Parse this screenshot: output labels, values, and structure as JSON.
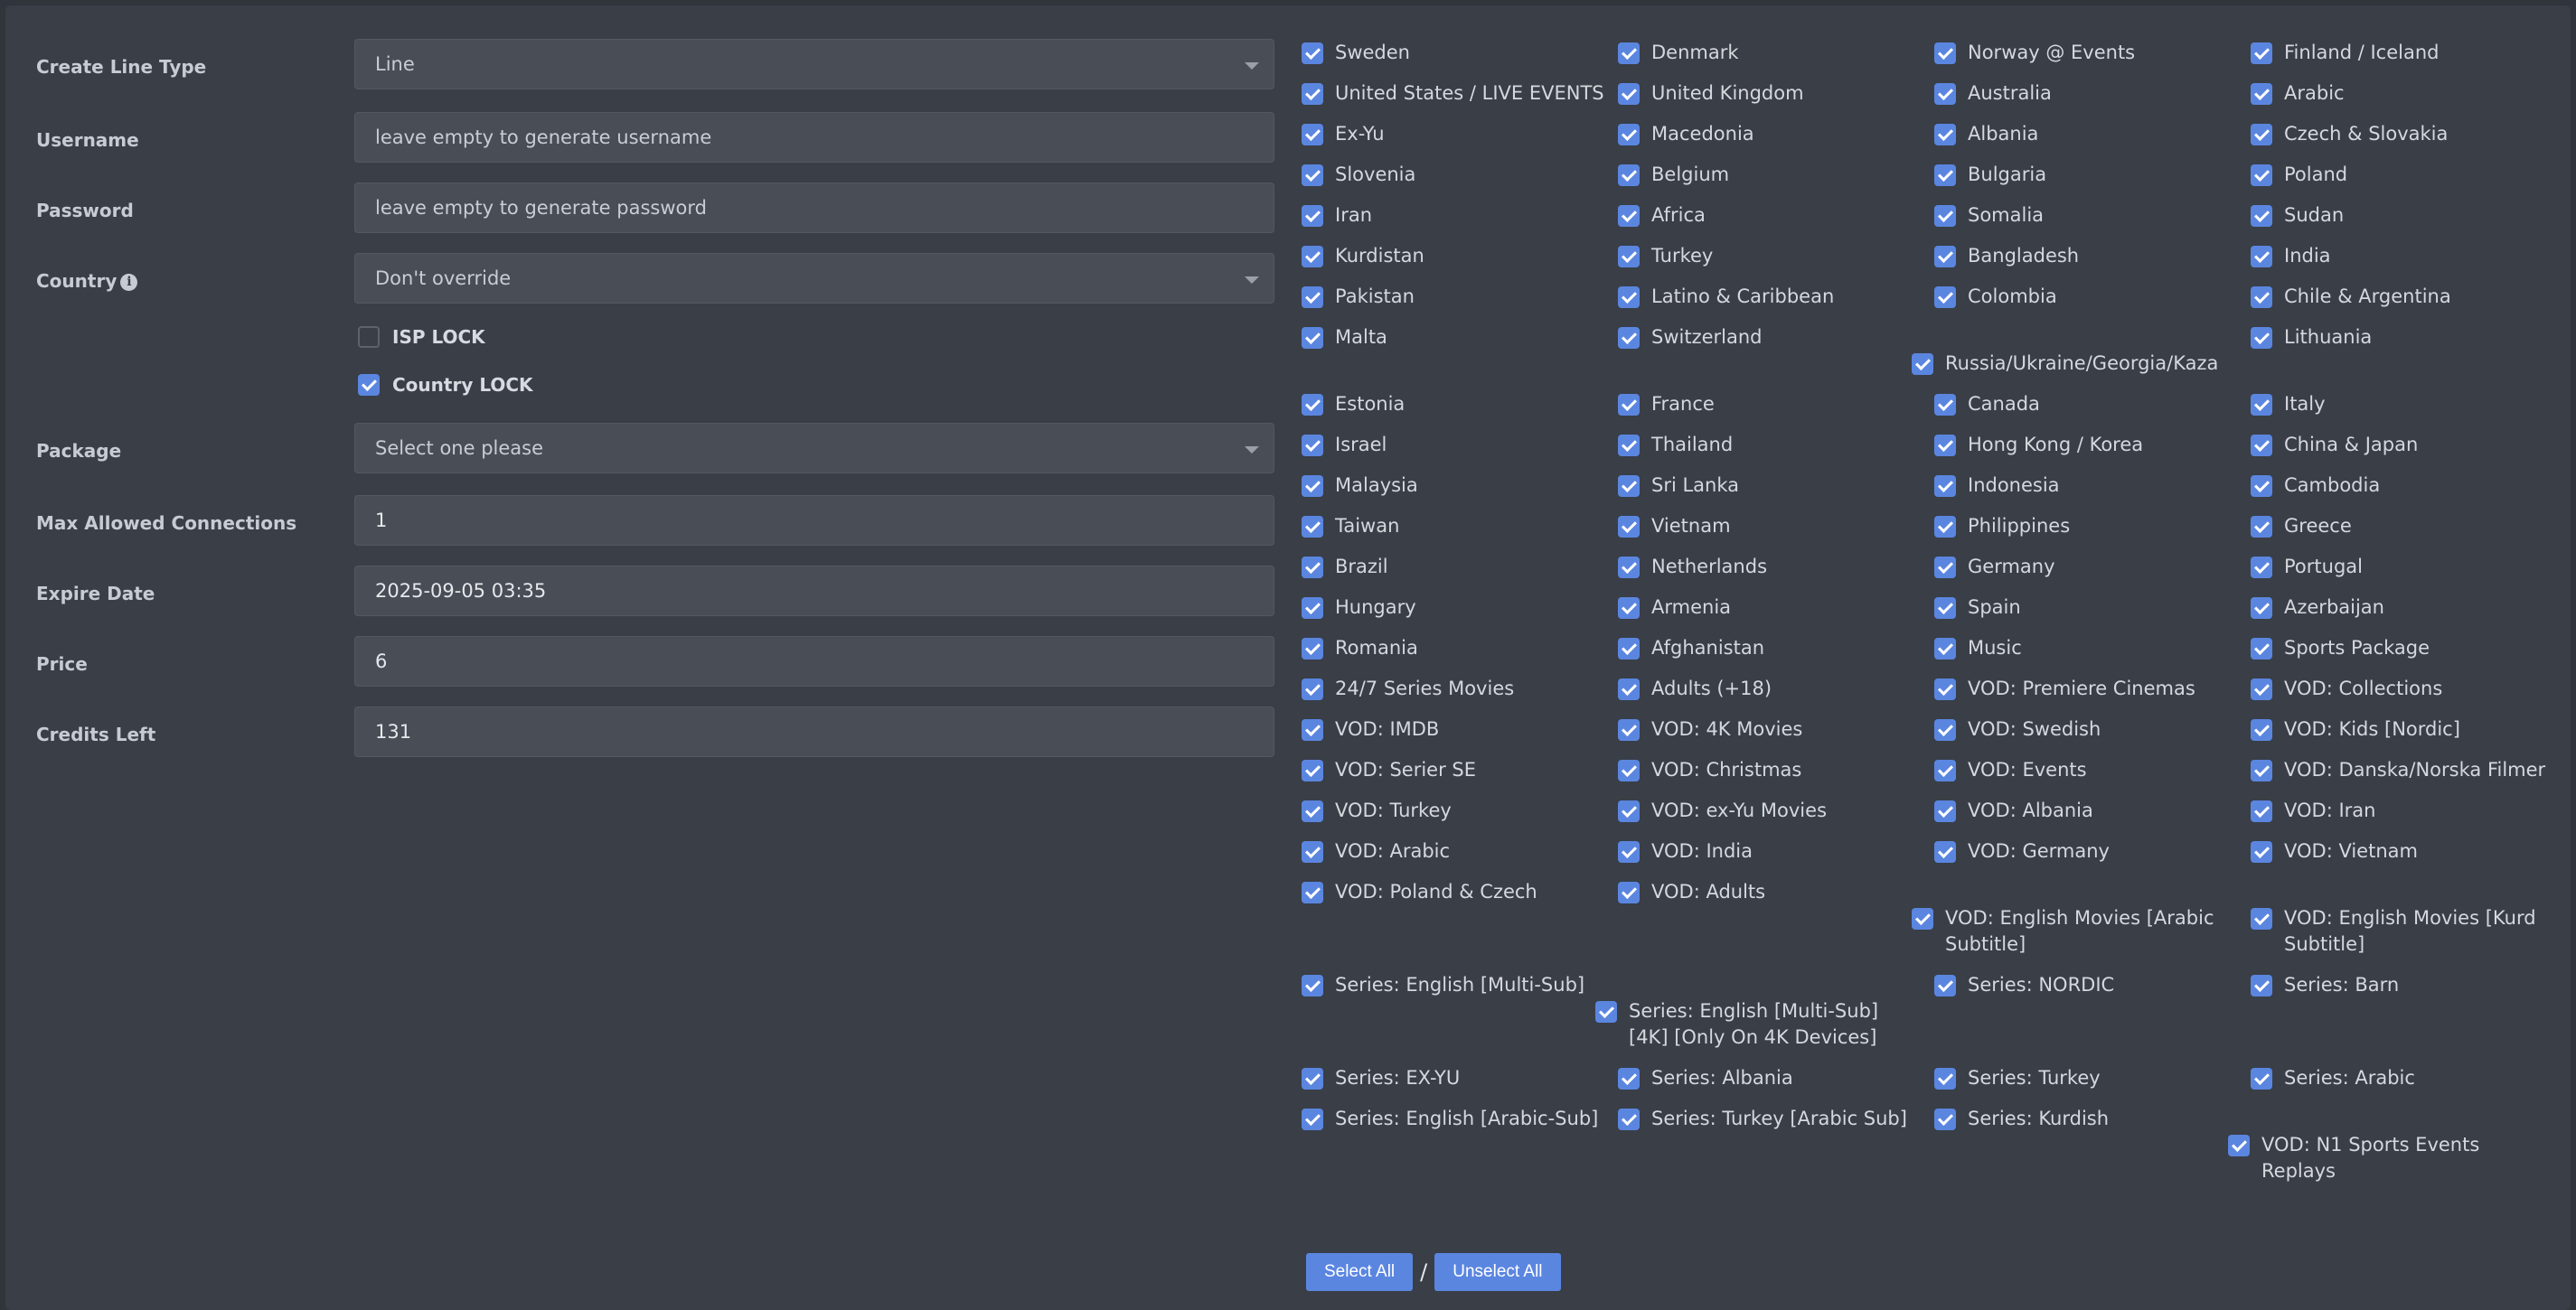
{
  "form": {
    "line_type": {
      "label": "Create Line Type",
      "value": "Line"
    },
    "username": {
      "label": "Username",
      "placeholder": "leave empty to generate username"
    },
    "password": {
      "label": "Password",
      "placeholder": "leave empty to generate password"
    },
    "country": {
      "label": "Country",
      "value": "Don't override",
      "info_icon": "info-icon"
    },
    "isp_lock": {
      "label": "ISP LOCK",
      "checked": false
    },
    "country_lock": {
      "label": "Country LOCK",
      "checked": true
    },
    "package": {
      "label": "Package",
      "value": "Select one please"
    },
    "max_connections": {
      "label": "Max Allowed Connections",
      "value": "1"
    },
    "expire_date": {
      "label": "Expire Date",
      "value": "2025-09-05 03:35"
    },
    "price": {
      "label": "Price",
      "value": "6"
    },
    "credits_left": {
      "label": "Credits Left",
      "value": "131"
    }
  },
  "bouquets": [
    "Sweden",
    "Denmark",
    "Norway @ Events",
    "Finland / Iceland",
    "United States / LIVE EVENTS",
    "United Kingdom",
    "Australia",
    "Arabic",
    "Ex-Yu",
    "Macedonia",
    "Albania",
    "Czech & Slovakia",
    "Slovenia",
    "Belgium",
    "Bulgaria",
    "Poland",
    "Iran",
    "Africa",
    "Somalia",
    "Sudan",
    "Kurdistan",
    "Turkey",
    "Bangladesh",
    "India",
    "Pakistan",
    "Latino & Caribbean",
    "Colombia",
    "Chile & Argentina",
    "Malta",
    "Switzerland",
    "Russia/Ukraine/Georgia/Kaza",
    "Lithuania",
    "Estonia",
    "France",
    "Canada",
    "Italy",
    "Israel",
    "Thailand",
    "Hong Kong / Korea",
    "China & Japan",
    "Malaysia",
    "Sri Lanka",
    "Indonesia",
    "Cambodia",
    "Taiwan",
    "Vietnam",
    "Philippines",
    "Greece",
    "Brazil",
    "Netherlands",
    "Germany",
    "Portugal",
    "Hungary",
    "Armenia",
    "Spain",
    "Azerbaijan",
    "Romania",
    "Afghanistan",
    "Music",
    "Sports Package",
    "24/7 Series Movies",
    "Adults (+18)",
    "VOD: Premiere Cinemas",
    "VOD: Collections",
    "VOD: IMDB",
    "VOD: 4K Movies",
    "VOD: Swedish",
    "VOD: Kids [Nordic]",
    "VOD: Serier SE",
    "VOD: Christmas",
    "VOD: Events",
    "VOD: Danska/Norska Filmer",
    "VOD: Turkey",
    "VOD: ex-Yu Movies",
    "VOD: Albania",
    "VOD: Iran",
    "VOD: Arabic",
    "VOD: India",
    "VOD: Germany",
    "VOD: Vietnam",
    "VOD: Poland & Czech",
    "VOD: Adults",
    "VOD: English Movies [Arabic Subtitle]",
    "VOD: English Movies [Kurd Subtitle]",
    "Series: English [Multi-Sub]",
    "Series: English [Multi-Sub] [4K] [Only On 4K Devices]",
    "Series: NORDIC",
    "Series: Barn",
    "Series: EX-YU",
    "Series: Albania",
    "Series: Turkey",
    "Series: Arabic",
    "Series: English [Arabic-Sub]",
    "Series: Turkey [Arabic Sub]",
    "Series: Kurdish",
    "VOD: N1 Sports Events Replays"
  ],
  "actions": {
    "select_all": "Select All",
    "separator": "/",
    "unselect_all": "Unselect All"
  }
}
